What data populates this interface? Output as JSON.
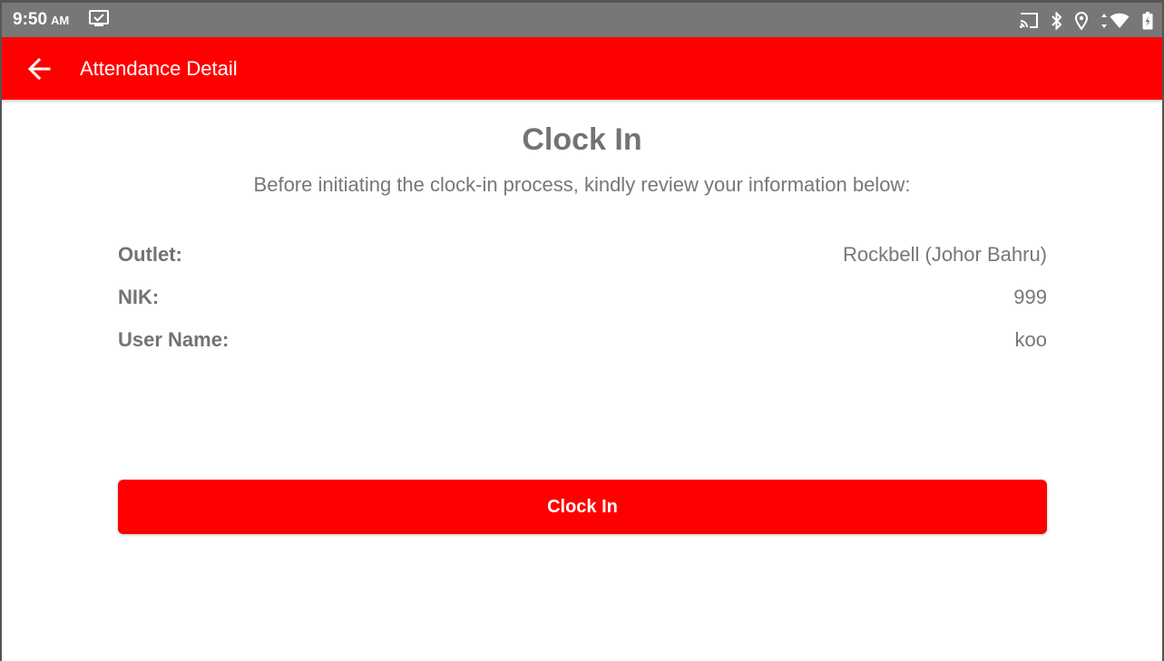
{
  "status_bar": {
    "time": "9:50",
    "ampm": "AM",
    "icons": [
      "notification-check-icon",
      "cast-icon",
      "bluetooth-icon",
      "location-icon",
      "data-arrows-icon",
      "wifi-icon",
      "battery-icon"
    ]
  },
  "app_bar": {
    "title": "Attendance Detail",
    "back_icon": "arrow-back-icon",
    "color": "#ff0000"
  },
  "content": {
    "title": "Clock In",
    "subtitle": "Before initiating the clock-in process, kindly review your information below:",
    "rows": [
      {
        "label": "Outlet:",
        "value": "Rockbell (Johor Bahru)"
      },
      {
        "label": "NIK:",
        "value": "999"
      },
      {
        "label": "User Name:",
        "value": "koo"
      }
    ],
    "button_label": "Clock In",
    "button_color": "#ff0000"
  }
}
